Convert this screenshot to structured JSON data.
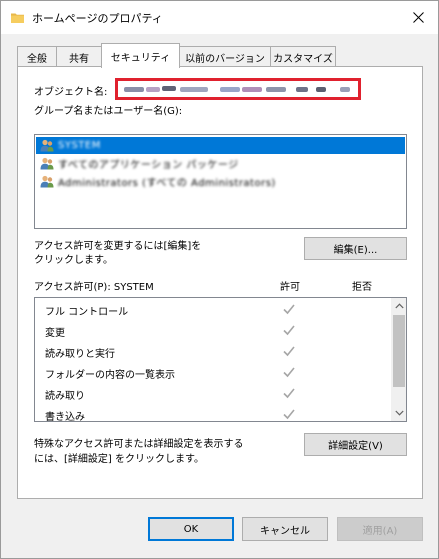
{
  "window": {
    "title": "ホームページのプロパティ",
    "close_glyph": "✕"
  },
  "tabs": [
    {
      "label": "全般",
      "active": false
    },
    {
      "label": "共有",
      "active": false
    },
    {
      "label": "セキュリティ",
      "active": true
    },
    {
      "label": "以前のバージョン",
      "active": false
    },
    {
      "label": "カスタマイズ",
      "active": false
    }
  ],
  "security": {
    "object_name_label": "オブジェクト名:",
    "groups_label": "グループ名またはユーザー名(G):",
    "groups": [
      {
        "name": "SYSTEM",
        "selected": true
      },
      {
        "name": "すべてのアプリケーション パッケージ",
        "selected": false
      },
      {
        "name": "Administrators (すべての Administrators)",
        "selected": false
      }
    ],
    "change_perm_text_1": "アクセス許可を変更するには[編集]を",
    "change_perm_text_2": "クリックします。",
    "edit_button": "編集(E)...",
    "permissions_label": "アクセス許可(P): SYSTEM",
    "allow_header": "許可",
    "deny_header": "拒否",
    "permissions": [
      {
        "name": "フル コントロール",
        "allow": true,
        "deny": false
      },
      {
        "name": "変更",
        "allow": true,
        "deny": false
      },
      {
        "name": "読み取りと実行",
        "allow": true,
        "deny": false
      },
      {
        "name": "フォルダーの内容の一覧表示",
        "allow": true,
        "deny": false
      },
      {
        "name": "読み取り",
        "allow": true,
        "deny": false
      },
      {
        "name": "書き込み",
        "allow": true,
        "deny": false
      }
    ],
    "advanced_text_1": "特殊なアクセス許可または詳細設定を表示する",
    "advanced_text_2": "には、[詳細設定] をクリックします。",
    "advanced_button": "詳細設定(V)"
  },
  "footer": {
    "ok": "OK",
    "cancel": "キャンセル",
    "apply": "適用(A)"
  },
  "colors": {
    "selection": "#0078d7",
    "redaction_border": "#e0212e",
    "check": "#a6a6a6"
  }
}
